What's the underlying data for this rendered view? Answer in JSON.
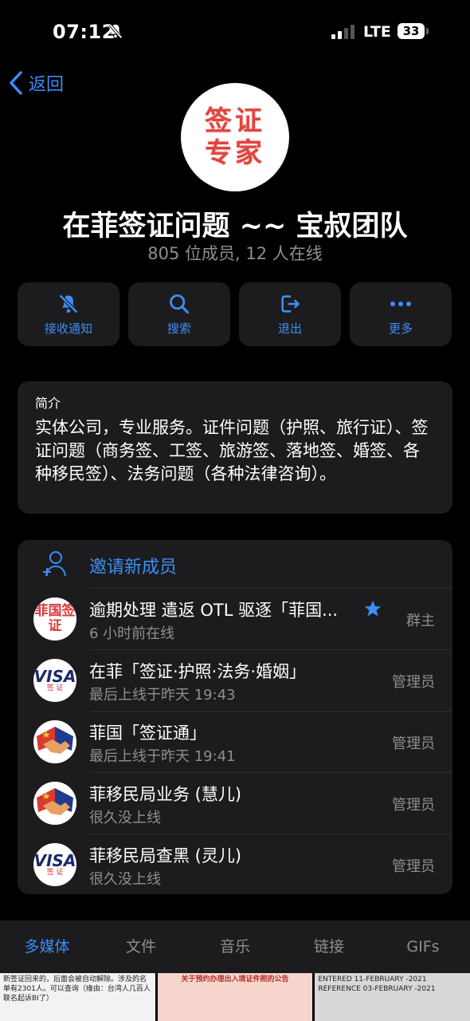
{
  "status": {
    "time": "07:12",
    "network": "LTE",
    "battery": "33"
  },
  "nav": {
    "back_label": "返回"
  },
  "group": {
    "avatar_line1": "签证",
    "avatar_line2": "专家",
    "title": "在菲签证问题 ~~ 宝叔团队",
    "subtitle": "805 位成员, 12 人在线"
  },
  "actions": [
    {
      "label": "接收通知",
      "icon": "bell-off-icon"
    },
    {
      "label": "搜索",
      "icon": "search-icon"
    },
    {
      "label": "退出",
      "icon": "exit-icon"
    },
    {
      "label": "更多",
      "icon": "more-icon"
    }
  ],
  "intro": {
    "label": "简介",
    "text": "实体公司，专业服务。证件问题（护照、旅行证）、签证问题（商务签、工签、旅游签、落地签、婚签、各种移民签）、法务问题（各种法律咨询）。"
  },
  "members": {
    "invite_label": "邀请新成员",
    "list": [
      {
        "name": "逾期处理 遣返 OTL 驱逐「菲国...",
        "status": "6 小时前在线",
        "role": "群主",
        "avatar": "菲国签证"
      },
      {
        "name": "在菲「签证·护照·法务·婚姻」",
        "status": "最后上线于昨天 19:43",
        "role": "管理员",
        "avatar": "VISA"
      },
      {
        "name": "菲国「签证通」",
        "status": "最后上线于昨天 19:41",
        "role": "管理员",
        "avatar": "handshake"
      },
      {
        "name": "菲移民局业务 (慧儿)",
        "status": "很久没上线",
        "role": "管理员",
        "avatar": "handshake"
      },
      {
        "name": "菲移民局查黑 (灵儿)",
        "status": "很久没上线",
        "role": "管理员",
        "avatar": "VISA"
      }
    ]
  },
  "visa_avatar": {
    "top": "VISA",
    "bottom": "签 证"
  },
  "tabs": [
    "多媒体",
    "文件",
    "音乐",
    "链接",
    "GIFs"
  ],
  "thumbs": [
    "新签证回来的，后面会被自动解除。涉及的名单有2301人。可以查询（缘由：台湾人几百人联名起诉BI了）",
    "关于预约办理出入境证件照的公告",
    "ENTERED 11-FEBRUARY -2021 REFERENCE 03-FEBRUARY -2021"
  ],
  "colors": {
    "accent": "#3a8ef6",
    "card": "#1c1c1e",
    "muted": "#8e8e93",
    "stamp": "#e0453f"
  }
}
